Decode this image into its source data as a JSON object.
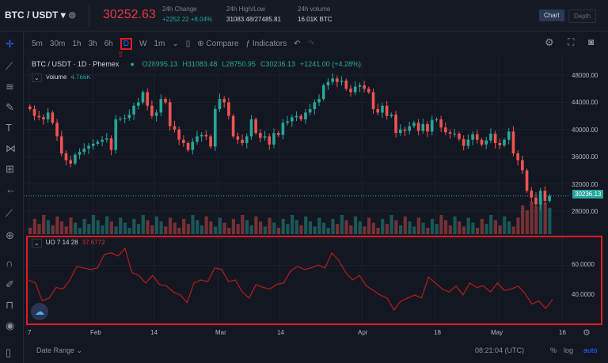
{
  "header": {
    "pair": "BTC / USDT",
    "last_price": "30252.63",
    "change_label": "24h Change",
    "change_value": "+2252.22 +8.04%",
    "hl_label": "24h High/Low",
    "hl_value": "31083.48/27485.81",
    "vol_label": "24h volume",
    "vol_value": "16.01K BTC",
    "chart_btn": "Chart",
    "depth_btn": "Depth"
  },
  "toolbar": {
    "intervals": [
      "5m",
      "30m",
      "1h",
      "3h",
      "6h",
      "D",
      "W",
      "1m"
    ],
    "selected": "D",
    "compare": "Compare",
    "indicators": "Indicators"
  },
  "legend": {
    "symbol": "BTC / USDT · 1D · Phemex",
    "o": "O28995.13",
    "h": "H31083.48",
    "l": "L28750.95",
    "c": "C30236.13",
    "chg": "+1241.00 (+4.28%)",
    "volume_label": "Volume",
    "volume_value": "4.766K"
  },
  "indicator": {
    "name": "UO 7 14 28",
    "value": "37.6772"
  },
  "price_axis": [
    "48000.00",
    "44000.00",
    "40000.00",
    "36000.00",
    "32000.00",
    "28000.00"
  ],
  "current_price_tag": "30236.13",
  "uo_axis": [
    "60.0000",
    "40.0000"
  ],
  "time_axis": [
    "7",
    "Feb",
    "14",
    "Mar",
    "14",
    "Apr",
    "18",
    "May",
    "16"
  ],
  "footer": {
    "date_range": "Date Range",
    "time": "08:21:04 (UTC)",
    "pct": "%",
    "log": "log",
    "auto": "auto"
  },
  "colors": {
    "up": "#26a69a",
    "down": "#ef5350",
    "accent": "#2962ff",
    "highlight": "#e01b24",
    "uo_line": "#b71c1c"
  },
  "chart_data": {
    "type": "candlestick",
    "ylim": [
      26000,
      49000
    ],
    "closes": [
      43000,
      42000,
      41800,
      41500,
      42500,
      41000,
      39000,
      36500,
      35500,
      35000,
      36300,
      36700,
      37200,
      37600,
      37900,
      38200,
      38500,
      38700,
      37000,
      41500,
      41600,
      41700,
      42200,
      43500,
      44000,
      45500,
      43500,
      42000,
      42500,
      44500,
      44000,
      40500,
      40000,
      38500,
      38000,
      37000,
      38200,
      39000,
      39200,
      39000,
      37500,
      43000,
      44500,
      44000,
      42000,
      39000,
      38500,
      38000,
      39000,
      41500,
      39500,
      38800,
      39000,
      37800,
      39500,
      39200,
      41000,
      41200,
      41800,
      42000,
      41500,
      42500,
      43000,
      44000,
      44500,
      46500,
      47000,
      47500,
      47000,
      47200,
      46000,
      45500,
      46300,
      46500,
      46000,
      45500,
      43000,
      42500,
      43500,
      42000,
      42200,
      39500,
      40000,
      39800,
      40500,
      41000,
      39800,
      40800,
      39700,
      41400,
      41500,
      40300,
      39600,
      39400,
      39400,
      38600,
      37600,
      38500,
      39300,
      38500,
      37800,
      38400,
      39400,
      38000,
      37700,
      38500,
      39700,
      36500,
      35500,
      34000,
      31000,
      30000,
      29000,
      31000,
      29500,
      30236
    ],
    "uo": [
      50,
      48,
      36,
      38,
      45,
      44,
      50,
      59,
      58,
      57,
      58,
      67,
      68,
      66,
      71,
      55,
      53,
      48,
      53,
      47,
      46,
      42,
      40,
      35,
      48,
      50,
      49,
      58,
      57,
      49,
      50,
      42,
      38,
      47,
      45,
      44,
      47,
      48,
      56,
      59,
      57,
      58,
      60,
      58,
      68,
      63,
      55,
      50,
      53,
      46,
      43,
      40,
      38,
      30,
      36,
      38,
      40,
      38,
      52,
      48,
      44,
      42,
      46,
      40,
      48,
      45,
      46,
      42,
      48,
      43,
      44,
      46,
      41,
      34,
      36,
      31,
      37
    ]
  }
}
